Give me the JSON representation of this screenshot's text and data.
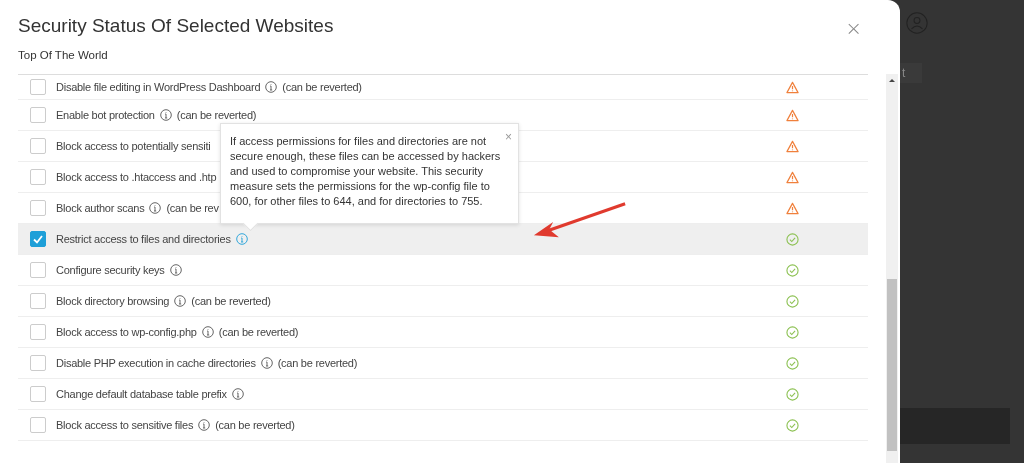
{
  "dialog": {
    "title": "Security Status Of Selected Websites",
    "subtitle": "Top Of The World",
    "close": "×"
  },
  "measures": [
    {
      "label": "Disable file editing in WordPress Dashboard",
      "info": true,
      "note": "(can be reverted)",
      "checked": false,
      "highlighted": false,
      "kind": "warning"
    },
    {
      "label": "Enable bot protection",
      "info": true,
      "note": "(can be reverted)",
      "checked": false,
      "highlighted": false,
      "kind": "warning"
    },
    {
      "label": "Block access to potentially sensiti",
      "info": false,
      "checked": false,
      "highlighted": false,
      "kind": "warning"
    },
    {
      "label": "Block access to .htaccess and .htp",
      "info": false,
      "checked": false,
      "highlighted": false,
      "kind": "warning"
    },
    {
      "label": "Block author scans",
      "info": true,
      "note": "(can be rev",
      "checked": false,
      "highlighted": false,
      "kind": "warning"
    },
    {
      "label": "Restrict access to files and directories",
      "info": true,
      "checked": true,
      "highlighted": true,
      "kind": "ok"
    },
    {
      "label": "Configure security keys",
      "info": true,
      "checked": false,
      "highlighted": false,
      "kind": "ok"
    },
    {
      "label": "Block directory browsing",
      "info": true,
      "note": "(can be reverted)",
      "checked": false,
      "highlighted": false,
      "kind": "ok"
    },
    {
      "label": "Block access to wp-config.php",
      "info": true,
      "note": "(can be reverted)",
      "checked": false,
      "highlighted": false,
      "kind": "ok"
    },
    {
      "label": "Disable PHP execution in cache directories",
      "info": true,
      "note": "(can be reverted)",
      "checked": false,
      "highlighted": false,
      "kind": "ok"
    },
    {
      "label": "Change default database table prefix",
      "info": true,
      "checked": false,
      "highlighted": false,
      "kind": "ok"
    },
    {
      "label": "Block access to sensitive files",
      "info": true,
      "note": "(can be reverted)",
      "checked": false,
      "highlighted": false,
      "kind": "ok"
    }
  ],
  "tooltip": {
    "text": "If access permissions for files and directories are not secure enough, these files can be accessed by hackers and used to compromise your website. This security measure sets the permissions for the wp-config file to 600, for other files to 644, and for directories to 755.",
    "close": "×"
  },
  "background": {
    "button": "t"
  }
}
